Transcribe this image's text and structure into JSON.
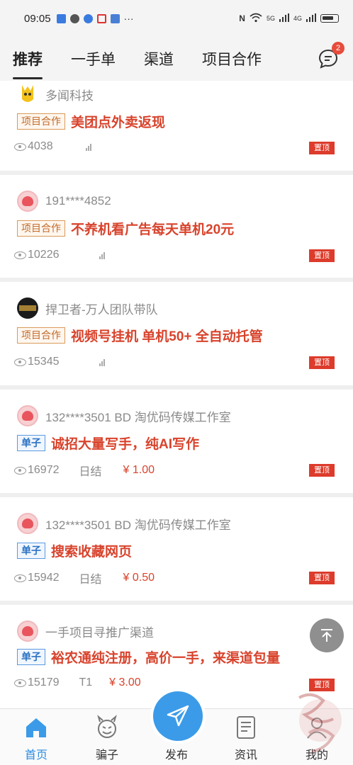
{
  "status_bar": {
    "time": "09:05",
    "network_1": "5G",
    "network_2": "4G"
  },
  "tabs": [
    {
      "label": "推荐",
      "active": true
    },
    {
      "label": "一手单",
      "active": false
    },
    {
      "label": "渠道",
      "active": false
    },
    {
      "label": "项目合作",
      "active": false
    }
  ],
  "messages": {
    "icon": "chat-bubble-icon",
    "badge": "2"
  },
  "posts": [
    {
      "author": "多闻科技",
      "avatar": "yellow-mascot",
      "tag": "项目合作",
      "tag_type": "coop",
      "title": "美团点外卖返现",
      "views": "4038",
      "settle": "",
      "price": "",
      "pin": "置顶"
    },
    {
      "author": "191****4852",
      "avatar": "pink-default",
      "tag": "项目合作",
      "tag_type": "coop",
      "title": "不养机看广告每天单机20元",
      "views": "10226",
      "settle": "",
      "price": "",
      "pin": "置顶"
    },
    {
      "author": "捍卫者-万人团队带队",
      "avatar": "dark-logo",
      "tag": "项目合作",
      "tag_type": "coop",
      "title": "视频号挂机 单机50+ 全自动托管",
      "views": "15345",
      "settle": "",
      "price": "",
      "pin": "置顶"
    },
    {
      "author": "132****3501 BD 淘优码传媒工作室",
      "avatar": "pink-default",
      "tag": "单子",
      "tag_type": "order",
      "title": "诚招大量写手，纯AI写作",
      "views": "16972",
      "settle": "日结",
      "price": "¥ 1.00",
      "pin": "置顶"
    },
    {
      "author": "132****3501 BD 淘优码传媒工作室",
      "avatar": "pink-default",
      "tag": "单子",
      "tag_type": "order",
      "title": "搜索收藏网页",
      "views": "15942",
      "settle": "日结",
      "price": "¥ 0.50",
      "pin": "置顶"
    },
    {
      "author": "一手项目寻推广渠道",
      "avatar": "pink-default",
      "tag": "单子",
      "tag_type": "order",
      "title": "裕农通纯注册，高价一手，来渠道包量",
      "views": "15179",
      "settle": "T1",
      "price": "¥ 3.00",
      "pin": "置顶"
    }
  ],
  "bottom_nav": [
    {
      "label": "首页",
      "icon": "home-icon",
      "active": true
    },
    {
      "label": "骗子",
      "icon": "devil-face-icon",
      "active": false
    },
    {
      "label": "发布",
      "icon": "paper-plane-icon",
      "active": false
    },
    {
      "label": "资讯",
      "icon": "news-icon",
      "active": false
    },
    {
      "label": "我的",
      "icon": "profile-icon",
      "active": false
    }
  ],
  "colors": {
    "accent_blue": "#3b9be8",
    "title_red": "#d8432c",
    "pin_red": "#dd3b2b",
    "coop_orange": "#c26a2a",
    "order_blue": "#2b72c4"
  }
}
